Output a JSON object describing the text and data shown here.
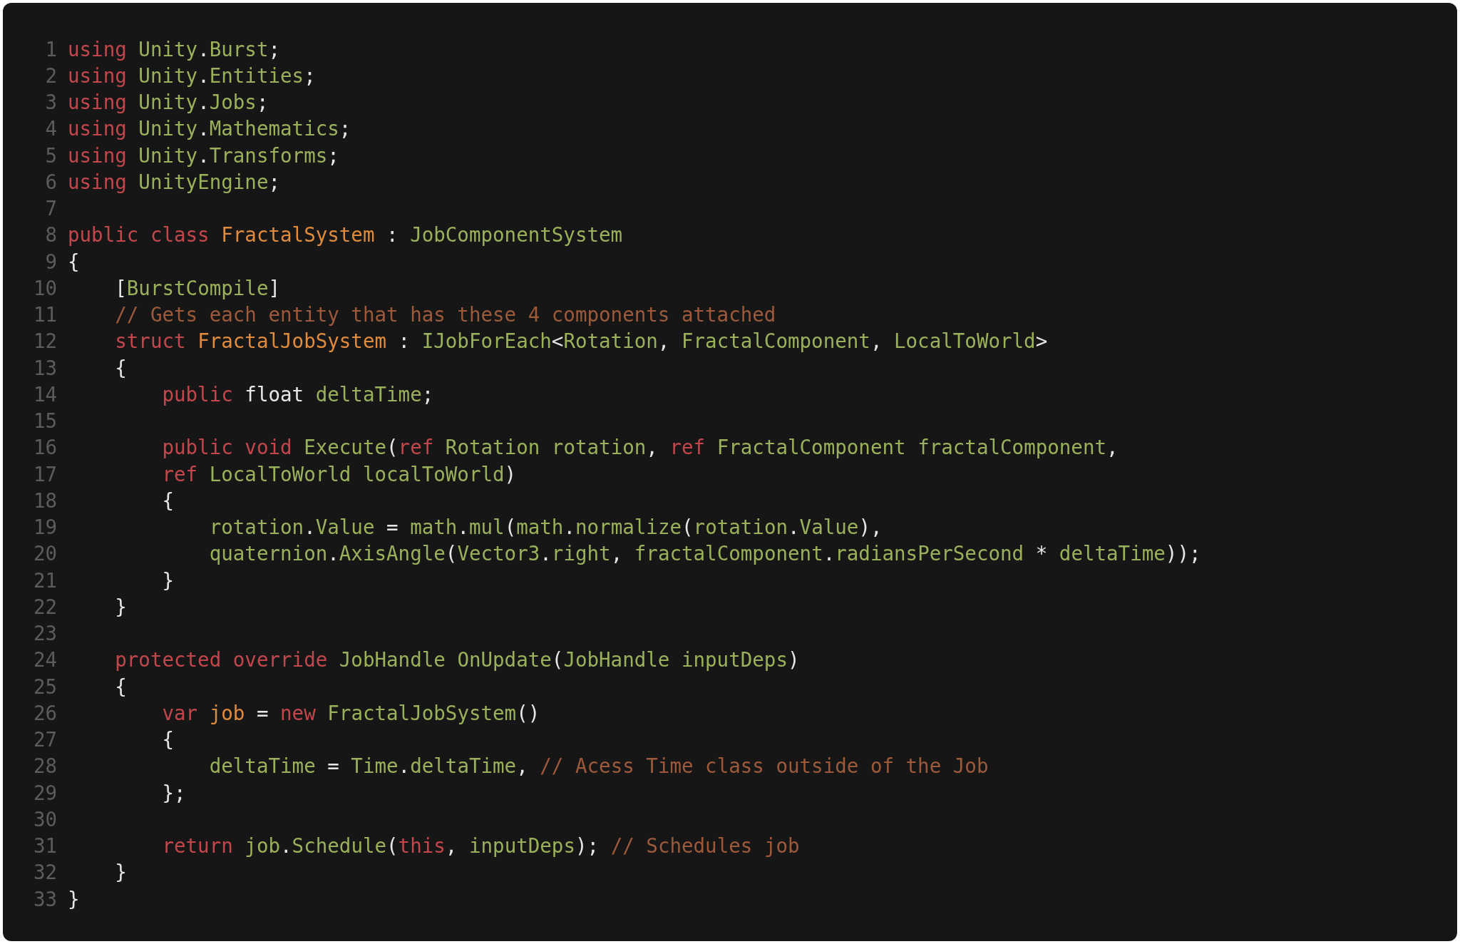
{
  "code_lines": [
    {
      "number": "1",
      "tokens": [
        {
          "kind": "keyword",
          "text": "using "
        },
        {
          "kind": "type",
          "text": "Unity"
        },
        {
          "kind": "plain",
          "text": "."
        },
        {
          "kind": "type",
          "text": "Burst"
        },
        {
          "kind": "plain",
          "text": ";"
        }
      ]
    },
    {
      "number": "2",
      "tokens": [
        {
          "kind": "keyword",
          "text": "using "
        },
        {
          "kind": "type",
          "text": "Unity"
        },
        {
          "kind": "plain",
          "text": "."
        },
        {
          "kind": "type",
          "text": "Entities"
        },
        {
          "kind": "plain",
          "text": ";"
        }
      ]
    },
    {
      "number": "3",
      "tokens": [
        {
          "kind": "keyword",
          "text": "using "
        },
        {
          "kind": "type",
          "text": "Unity"
        },
        {
          "kind": "plain",
          "text": "."
        },
        {
          "kind": "type",
          "text": "Jobs"
        },
        {
          "kind": "plain",
          "text": ";"
        }
      ]
    },
    {
      "number": "4",
      "tokens": [
        {
          "kind": "keyword",
          "text": "using "
        },
        {
          "kind": "type",
          "text": "Unity"
        },
        {
          "kind": "plain",
          "text": "."
        },
        {
          "kind": "type",
          "text": "Mathematics"
        },
        {
          "kind": "plain",
          "text": ";"
        }
      ]
    },
    {
      "number": "5",
      "tokens": [
        {
          "kind": "keyword",
          "text": "using "
        },
        {
          "kind": "type",
          "text": "Unity"
        },
        {
          "kind": "plain",
          "text": "."
        },
        {
          "kind": "type",
          "text": "Transforms"
        },
        {
          "kind": "plain",
          "text": ";"
        }
      ]
    },
    {
      "number": "6",
      "tokens": [
        {
          "kind": "keyword",
          "text": "using "
        },
        {
          "kind": "type",
          "text": "UnityEngine"
        },
        {
          "kind": "plain",
          "text": ";"
        }
      ]
    },
    {
      "number": "7"
    },
    {
      "number": "8",
      "tokens": [
        {
          "kind": "keyword",
          "text": "public class "
        },
        {
          "kind": "name",
          "text": "FractalSystem"
        },
        {
          "kind": "plain",
          "text": " : "
        },
        {
          "kind": "type",
          "text": "JobComponentSystem"
        }
      ]
    },
    {
      "number": "9",
      "tokens": [
        {
          "kind": "plain",
          "text": "{"
        }
      ]
    },
    {
      "number": "10",
      "tokens": [
        {
          "kind": "plain",
          "text": "    ["
        },
        {
          "kind": "type",
          "text": "BurstCompile"
        },
        {
          "kind": "plain",
          "text": "]"
        }
      ]
    },
    {
      "number": "11",
      "tokens": [
        {
          "kind": "comment",
          "text": "    // Gets each entity that has these 4 components attached"
        }
      ]
    },
    {
      "number": "12",
      "tokens": [
        {
          "kind": "keyword",
          "text": "    struct "
        },
        {
          "kind": "name",
          "text": "FractalJobSystem"
        },
        {
          "kind": "plain",
          "text": " : "
        },
        {
          "kind": "type",
          "text": "IJobForEach"
        },
        {
          "kind": "plain",
          "text": "<"
        },
        {
          "kind": "type",
          "text": "Rotation"
        },
        {
          "kind": "plain",
          "text": ", "
        },
        {
          "kind": "type",
          "text": "FractalComponent"
        },
        {
          "kind": "plain",
          "text": ", "
        },
        {
          "kind": "type",
          "text": "LocalToWorld"
        },
        {
          "kind": "plain",
          "text": ">"
        }
      ]
    },
    {
      "number": "13",
      "tokens": [
        {
          "kind": "plain",
          "text": "    {"
        }
      ]
    },
    {
      "number": "14",
      "tokens": [
        {
          "kind": "keyword",
          "text": "        public "
        },
        {
          "kind": "plain",
          "text": "float "
        },
        {
          "kind": "type",
          "text": "deltaTime"
        },
        {
          "kind": "plain",
          "text": ";"
        }
      ]
    },
    {
      "number": "15"
    },
    {
      "number": "16",
      "tokens": [
        {
          "kind": "keyword",
          "text": "        public void "
        },
        {
          "kind": "type",
          "text": "Execute"
        },
        {
          "kind": "plain",
          "text": "("
        },
        {
          "kind": "keyword",
          "text": "ref "
        },
        {
          "kind": "type",
          "text": "Rotation rotation"
        },
        {
          "kind": "plain",
          "text": ", "
        },
        {
          "kind": "keyword",
          "text": "ref "
        },
        {
          "kind": "type",
          "text": "FractalComponent fractalComponent"
        },
        {
          "kind": "plain",
          "text": ","
        }
      ]
    },
    {
      "number": "17",
      "tokens": [
        {
          "kind": "keyword",
          "text": "        ref "
        },
        {
          "kind": "type",
          "text": "LocalToWorld localToWorld"
        },
        {
          "kind": "plain",
          "text": ")"
        }
      ]
    },
    {
      "number": "18",
      "tokens": [
        {
          "kind": "plain",
          "text": "        {"
        }
      ]
    },
    {
      "number": "19",
      "tokens": [
        {
          "kind": "type",
          "text": "            rotation"
        },
        {
          "kind": "plain",
          "text": "."
        },
        {
          "kind": "type",
          "text": "Value"
        },
        {
          "kind": "plain",
          "text": " = "
        },
        {
          "kind": "type",
          "text": "math"
        },
        {
          "kind": "plain",
          "text": "."
        },
        {
          "kind": "type",
          "text": "mul"
        },
        {
          "kind": "plain",
          "text": "("
        },
        {
          "kind": "type",
          "text": "math"
        },
        {
          "kind": "plain",
          "text": "."
        },
        {
          "kind": "type",
          "text": "normalize"
        },
        {
          "kind": "plain",
          "text": "("
        },
        {
          "kind": "type",
          "text": "rotation"
        },
        {
          "kind": "plain",
          "text": "."
        },
        {
          "kind": "type",
          "text": "Value"
        },
        {
          "kind": "plain",
          "text": "),"
        }
      ]
    },
    {
      "number": "20",
      "tokens": [
        {
          "kind": "type",
          "text": "            quaternion"
        },
        {
          "kind": "plain",
          "text": "."
        },
        {
          "kind": "type",
          "text": "AxisAngle"
        },
        {
          "kind": "plain",
          "text": "("
        },
        {
          "kind": "type",
          "text": "Vector3"
        },
        {
          "kind": "plain",
          "text": "."
        },
        {
          "kind": "type",
          "text": "right"
        },
        {
          "kind": "plain",
          "text": ", "
        },
        {
          "kind": "type",
          "text": "fractalComponent"
        },
        {
          "kind": "plain",
          "text": "."
        },
        {
          "kind": "type",
          "text": "radiansPerSecond"
        },
        {
          "kind": "plain",
          "text": " * "
        },
        {
          "kind": "type",
          "text": "deltaTime"
        },
        {
          "kind": "plain",
          "text": "));"
        }
      ]
    },
    {
      "number": "21",
      "tokens": [
        {
          "kind": "plain",
          "text": "        }"
        }
      ]
    },
    {
      "number": "22",
      "tokens": [
        {
          "kind": "plain",
          "text": "    }"
        }
      ]
    },
    {
      "number": "23"
    },
    {
      "number": "24",
      "tokens": [
        {
          "kind": "keyword",
          "text": "    protected override "
        },
        {
          "kind": "type",
          "text": "JobHandle OnUpdate"
        },
        {
          "kind": "plain",
          "text": "("
        },
        {
          "kind": "type",
          "text": "JobHandle inputDeps"
        },
        {
          "kind": "plain",
          "text": ")"
        }
      ]
    },
    {
      "number": "25",
      "tokens": [
        {
          "kind": "plain",
          "text": "    {"
        }
      ]
    },
    {
      "number": "26",
      "tokens": [
        {
          "kind": "keyword",
          "text": "        var "
        },
        {
          "kind": "name",
          "text": "job"
        },
        {
          "kind": "plain",
          "text": " = "
        },
        {
          "kind": "keyword",
          "text": "new "
        },
        {
          "kind": "type",
          "text": "FractalJobSystem"
        },
        {
          "kind": "plain",
          "text": "()"
        }
      ]
    },
    {
      "number": "27",
      "tokens": [
        {
          "kind": "plain",
          "text": "        {"
        }
      ]
    },
    {
      "number": "28",
      "tokens": [
        {
          "kind": "type",
          "text": "            deltaTime"
        },
        {
          "kind": "plain",
          "text": " = "
        },
        {
          "kind": "type",
          "text": "Time"
        },
        {
          "kind": "plain",
          "text": "."
        },
        {
          "kind": "type",
          "text": "deltaTime"
        },
        {
          "kind": "plain",
          "text": ", "
        },
        {
          "kind": "comment",
          "text": "// Acess Time class outside of the Job"
        }
      ]
    },
    {
      "number": "29",
      "tokens": [
        {
          "kind": "plain",
          "text": "        };"
        }
      ]
    },
    {
      "number": "30"
    },
    {
      "number": "31",
      "tokens": [
        {
          "kind": "keyword",
          "text": "        return "
        },
        {
          "kind": "type",
          "text": "job"
        },
        {
          "kind": "plain",
          "text": "."
        },
        {
          "kind": "type",
          "text": "Schedule"
        },
        {
          "kind": "plain",
          "text": "("
        },
        {
          "kind": "keyword",
          "text": "this"
        },
        {
          "kind": "plain",
          "text": ", "
        },
        {
          "kind": "type",
          "text": "inputDeps"
        },
        {
          "kind": "plain",
          "text": "); "
        },
        {
          "kind": "comment",
          "text": "// Schedules job"
        }
      ]
    },
    {
      "number": "32",
      "tokens": [
        {
          "kind": "plain",
          "text": "    }"
        }
      ]
    },
    {
      "number": "33",
      "tokens": [
        {
          "kind": "plain",
          "text": "}"
        }
      ]
    }
  ]
}
